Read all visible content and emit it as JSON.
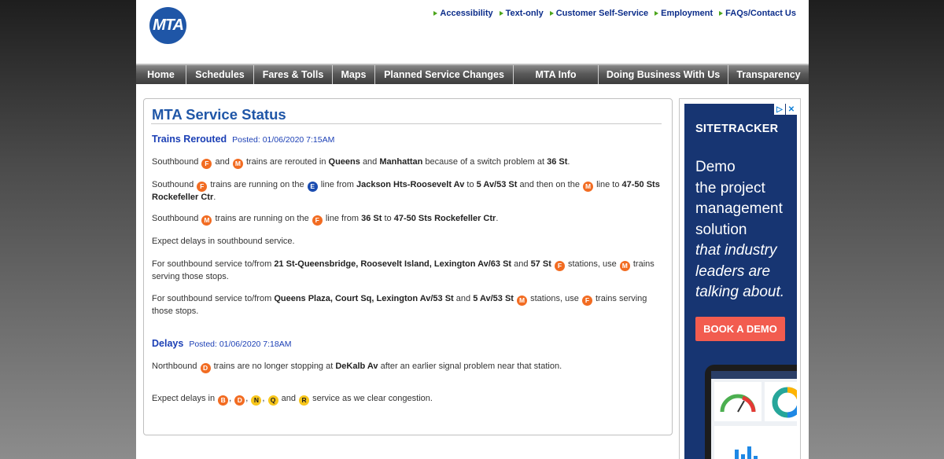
{
  "header": {
    "logo": "MTA",
    "links": [
      "Accessibility",
      "Text-only",
      "Customer Self-Service",
      "Employment",
      "FAQs/Contact Us"
    ]
  },
  "nav": [
    "Home",
    "Schedules",
    "Fares & Tolls",
    "Maps",
    "Planned Service Changes",
    "MTA Info",
    "Doing Business With Us",
    "Transparency"
  ],
  "main": {
    "title": "MTA Service Status",
    "sections": [
      {
        "title": "Trains Rerouted",
        "posted": "Posted: 01/06/2020  7:15AM"
      },
      {
        "title": "Delays",
        "posted": "Posted: 01/06/2020  7:18AM"
      }
    ],
    "text": {
      "southbound": "Southbound",
      "southound": "Southound",
      "northbound": "Northbound",
      "and": "and",
      "p1_mid": "trains are rerouted in",
      "queens": "Queens",
      "manhattan": "Manhattan",
      "p1_tail": "because of a switch problem at",
      "st36": "36 St",
      "period": ".",
      "p2_a": "trains are running on the",
      "p2_b": "line from",
      "jackson": "Jackson Hts-Roosevelt Av",
      "to": "to",
      "av53": "5 Av/53 St",
      "p2_c": "and then on the",
      "p2_d": "line to",
      "rock": "47-50 Sts Rockefeller Ctr",
      "p3_a": "trains are running on the",
      "p3_b": "line from",
      "p4": "Expect delays in southbound service.",
      "p5_a": "For southbound service to/from",
      "p5_stations": "21 St-Queensbridge, Roosevelt Island, Lexington Av/63 St",
      "st57": "57 St",
      "stations_use": "stations, use",
      "serving": "trains serving those stops.",
      "p6_stations": "Queens Plaza, Court Sq, Lexington Av/53 St",
      "d1_a": "trains are no longer stopping at",
      "dekalb": "DeKalb Av",
      "d1_b": "after an earlier signal problem near that station.",
      "d2_a": "Expect delays in",
      "comma": ",",
      "d2_b": "service as we clear congestion."
    },
    "bullets": {
      "F": "F",
      "M": "M",
      "E": "E",
      "D": "D",
      "B": "B",
      "N": "N",
      "Q": "Q",
      "R": "R"
    }
  },
  "ad": {
    "brand": "SITETRACKER",
    "lines": [
      "Demo",
      "the project",
      "management",
      "solution"
    ],
    "italic_lines": [
      "that industry",
      "leaders are",
      "talking about."
    ],
    "button": "BOOK A DEMO",
    "choice_icons": [
      "adchoices-icon",
      "close-icon"
    ]
  },
  "colors": {
    "mta_blue": "#1f56a7",
    "orange_line": "#f26c22",
    "blue_line": "#1a4cb0",
    "yellow_line": "#f8c61b",
    "ad_bg": "#173572",
    "ad_button": "#f25c4f"
  }
}
